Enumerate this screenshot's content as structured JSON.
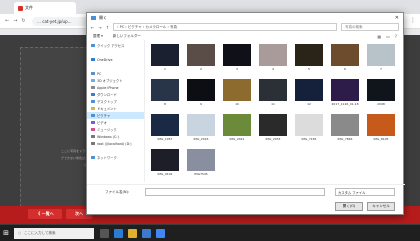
{
  "browser": {
    "tab_title": "文件",
    "url": "… cat-yet.jp/up…",
    "nav_back": "←",
    "nav_forward": "→",
    "nav_reload": "↻",
    "menu": "⋮"
  },
  "site": {
    "drop_text": "ここに写真をドラッグしてください。ドラッグできない場合はアップロードボタンを押してください",
    "back_button": "《 一覧へ",
    "next_button": "次へ"
  },
  "dialog": {
    "title": "開く",
    "path": "› PC › ピクチャ › カメラロール › 写真",
    "search_placeholder": "写真の検索",
    "toolbar": {
      "organize": "整理 ▾",
      "new_folder": "新しいフォルダー"
    },
    "nav_items": [
      {
        "label": "クイック アクセス",
        "color": "#4a90d9",
        "selected": false
      },
      {
        "label": "",
        "color": "#ffffff",
        "selected": false
      },
      {
        "label": "OneDrive",
        "color": "#2b7cd3",
        "selected": false
      },
      {
        "label": "",
        "color": "#ffffff",
        "selected": false
      },
      {
        "label": "PC",
        "color": "#5a8fc9",
        "selected": false
      },
      {
        "label": "3D オブジェクト",
        "color": "#6bb0e0",
        "selected": false
      },
      {
        "label": "Apple iPhone",
        "color": "#888888",
        "selected": false
      },
      {
        "label": "ダウンロード",
        "color": "#3b7ad0",
        "selected": false
      },
      {
        "label": "デスクトップ",
        "color": "#4a90d9",
        "selected": false
      },
      {
        "label": "ドキュメント",
        "color": "#d9b34a",
        "selected": false
      },
      {
        "label": "ピクチャ",
        "color": "#4a90d9",
        "selected": true
      },
      {
        "label": "ビデオ",
        "color": "#7a5ad9",
        "selected": false
      },
      {
        "label": "ミュージック",
        "color": "#d94a8a",
        "selected": false
      },
      {
        "label": "Windows (C:)",
        "color": "#777777",
        "selected": false
      },
      {
        "label": "root (\\\\localhost) (D:)",
        "color": "#777777",
        "selected": false
      },
      {
        "label": "",
        "color": "#ffffff",
        "selected": false
      },
      {
        "label": "ネットワーク",
        "color": "#4a90d9",
        "selected": false
      }
    ],
    "thumbnails": [
      {
        "caption": "1",
        "color": "#1b2030"
      },
      {
        "caption": "2",
        "color": "#5a4d48"
      },
      {
        "caption": "3",
        "color": "#101018"
      },
      {
        "caption": "4",
        "color": "#a89b9a"
      },
      {
        "caption": "5",
        "color": "#2a2418"
      },
      {
        "caption": "6",
        "color": "#6d4b2d"
      },
      {
        "caption": "7",
        "color": "#b7c2c9"
      },
      {
        "caption": "8",
        "color": "#283548"
      },
      {
        "caption": "9",
        "color": "#0c0e14"
      },
      {
        "caption": "10",
        "color": "#8d6b2e"
      },
      {
        "caption": "11",
        "color": "#2b2f36"
      },
      {
        "caption": "12",
        "color": "#15203a"
      },
      {
        "caption": "2017_1126_01-18",
        "color": "#2d1b4a"
      },
      {
        "caption": "2098",
        "color": "#10151c"
      },
      {
        "caption": "IMG_1957",
        "color": "#1a2a45"
      },
      {
        "caption": "IMG_2016",
        "color": "#c8d4e0"
      },
      {
        "caption": "IMG_2021",
        "color": "#6b8a3a"
      },
      {
        "caption": "IMG_2033",
        "color": "#2a2a2a"
      },
      {
        "caption": "IMG_7165",
        "color": "#dcdcdc"
      },
      {
        "caption": "IMG_7846",
        "color": "#8a8a8a"
      },
      {
        "caption": "IMG_8105",
        "color": "#c55a1a"
      },
      {
        "caption": "IMG_9102",
        "color": "#1e1e28"
      },
      {
        "caption": "IMG7545",
        "color": "#8a8fa0"
      }
    ],
    "filename_label": "ファイル名(N):",
    "filetype": "カスタム ファイル",
    "open_button": "開く(O)",
    "cancel_button": "キャンセル"
  },
  "taskbar": {
    "search_placeholder": "ここに入力して検索",
    "clock_time": "",
    "clock_date": ""
  }
}
